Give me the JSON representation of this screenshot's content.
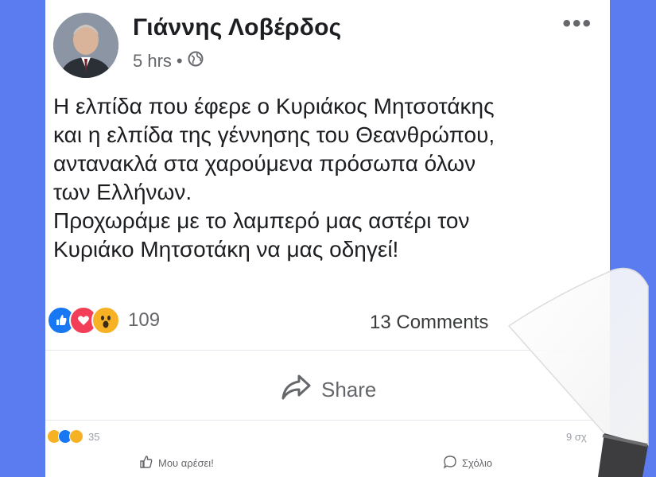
{
  "post": {
    "author": "Γιάννης Λοβέρδος",
    "time": "5 hrs",
    "separator": "•",
    "more_label": "•••",
    "text_lines": [
      "Η ελπίδα που έφερε ο Κυριάκος Μητσοτάκης",
      "και η ελπίδα της γέννησης του Θεανθρώπου,",
      "αντανακλά στα χαρούμενα πρόσωπα όλων",
      "των Ελλήνων.",
      "Προχωράμε με το λαμπερό μας αστέρι τον",
      "Κυριάκο Μητσοτάκη να μας οδηγεί!"
    ]
  },
  "stats": {
    "reaction_icons": [
      "like-icon",
      "love-icon",
      "wow-icon"
    ],
    "reaction_count": "109",
    "comments": "13 Comments"
  },
  "actions": {
    "share_label": "Share"
  },
  "lower_post": {
    "reaction_icons": [
      "haha-icon",
      "like-icon",
      "sad-icon"
    ],
    "reaction_count": "35",
    "right_text": "9 σχ",
    "like_label": "Μου αρέσει!",
    "comment_label": "Σχόλιο"
  },
  "colors": {
    "background": "#5b7cf0",
    "like_blue": "#1877f2",
    "love_red": "#f33e58",
    "wow_yellow": "#f7b125",
    "text": "#1c1e21",
    "secondary": "#65676b"
  }
}
